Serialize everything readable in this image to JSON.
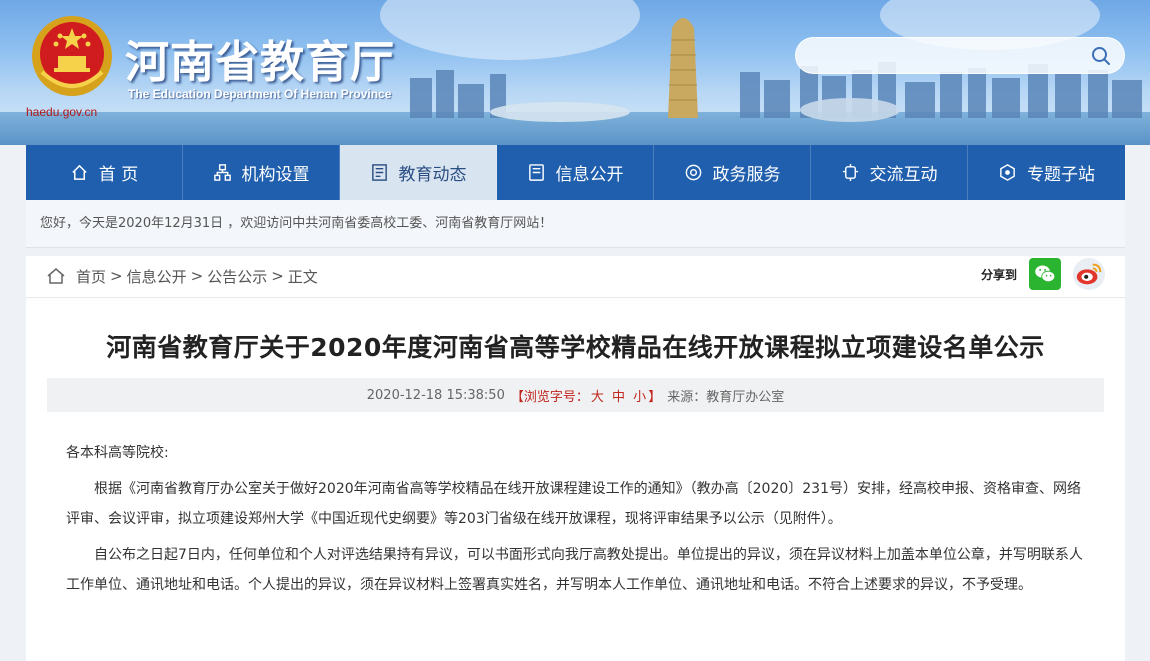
{
  "header": {
    "site_title": "河南省教育厅",
    "site_subtitle": "The Education Department Of Henan Province",
    "site_url": "haedu.gov.cn",
    "search_placeholder": ""
  },
  "nav": {
    "items": [
      {
        "label": "首 页",
        "icon": "home-icon",
        "active": false
      },
      {
        "label": "机构设置",
        "icon": "org-icon",
        "active": false
      },
      {
        "label": "教育动态",
        "icon": "news-icon",
        "active": true
      },
      {
        "label": "信息公开",
        "icon": "document-icon",
        "active": false
      },
      {
        "label": "政务服务",
        "icon": "service-icon",
        "active": false
      },
      {
        "label": "交流互动",
        "icon": "interaction-icon",
        "active": false
      },
      {
        "label": "专题子站",
        "icon": "topic-icon",
        "active": false
      }
    ]
  },
  "greeting": "您好，今天是2020年12月31日 ，欢迎访问中共河南省委高校工委、河南省教育厅网站！",
  "breadcrumb": {
    "home": "首页",
    "sep1": ">",
    "level1": "信息公开",
    "sep2": ">",
    "level2": "公告公示",
    "sep3": ">",
    "level3": "正文"
  },
  "share": {
    "label": "分享到",
    "wechat_icon": "wechat-icon",
    "weibo_icon": "weibo-icon"
  },
  "article": {
    "title": "河南省教育厅关于2020年度河南省高等学校精品在线开放课程拟立项建设名单公示",
    "date": "2020-12-18 15:38:50",
    "fontsize_prefix": "【浏览字号：",
    "fontsize_large": "大",
    "fontsize_medium": "中",
    "fontsize_small": "小",
    "fontsize_suffix": "】",
    "source": "来源：教育厅办公室",
    "salutation": "各本科高等院校:",
    "paragraph1": "根据《河南省教育厅办公室关于做好2020年河南省高等学校精品在线开放课程建设工作的通知》（教办高〔2020〕231号）安排，经高校申报、资格审查、网络评审、会议评审，拟立项建设郑州大学《中国近现代史纲要》等203门省级在线开放课程，现将评审结果予以公示（见附件）。",
    "paragraph2": "自公布之日起7日内，任何单位和个人对评选结果持有异议，可以书面形式向我厅高教处提出。单位提出的异议，须在异议材料上加盖本单位公章，并写明联系人工作单位、通讯地址和电话。个人提出的异议，须在异议材料上签署真实姓名，并写明本人工作单位、通讯地址和电话。不符合上述要求的异议，不予受理。"
  },
  "colors": {
    "nav_bg": "#1f5fae",
    "nav_active_bg": "#d9e4f1",
    "accent_red": "#c0261d"
  }
}
